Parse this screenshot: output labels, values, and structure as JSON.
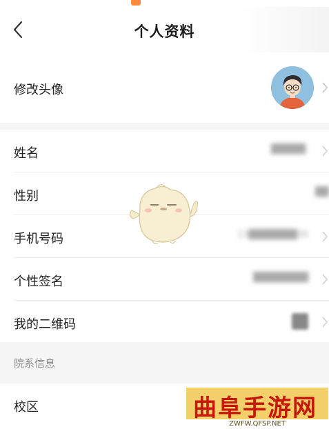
{
  "nav": {
    "title": "个人资料"
  },
  "avatar_row": {
    "label": "修改头像"
  },
  "profile_rows": [
    {
      "label": "姓名",
      "value": "█████"
    },
    {
      "label": "性别",
      "value": "██"
    },
    {
      "label": "手机号码",
      "value": "13███████00"
    },
    {
      "label": "个性签名",
      "value": "████████"
    },
    {
      "label": "我的二维码",
      "value": ""
    }
  ],
  "section": {
    "title": "院系信息"
  },
  "campus_row": {
    "label": "校区"
  },
  "watermark": {
    "title": "曲阜手游网",
    "url": "ZWFW.QFSP.NET"
  },
  "colors": {
    "background": "#f5f5f5",
    "surface": "#ffffff",
    "watermark_bg": "#f4d06a",
    "watermark_text": "#c7170b"
  }
}
